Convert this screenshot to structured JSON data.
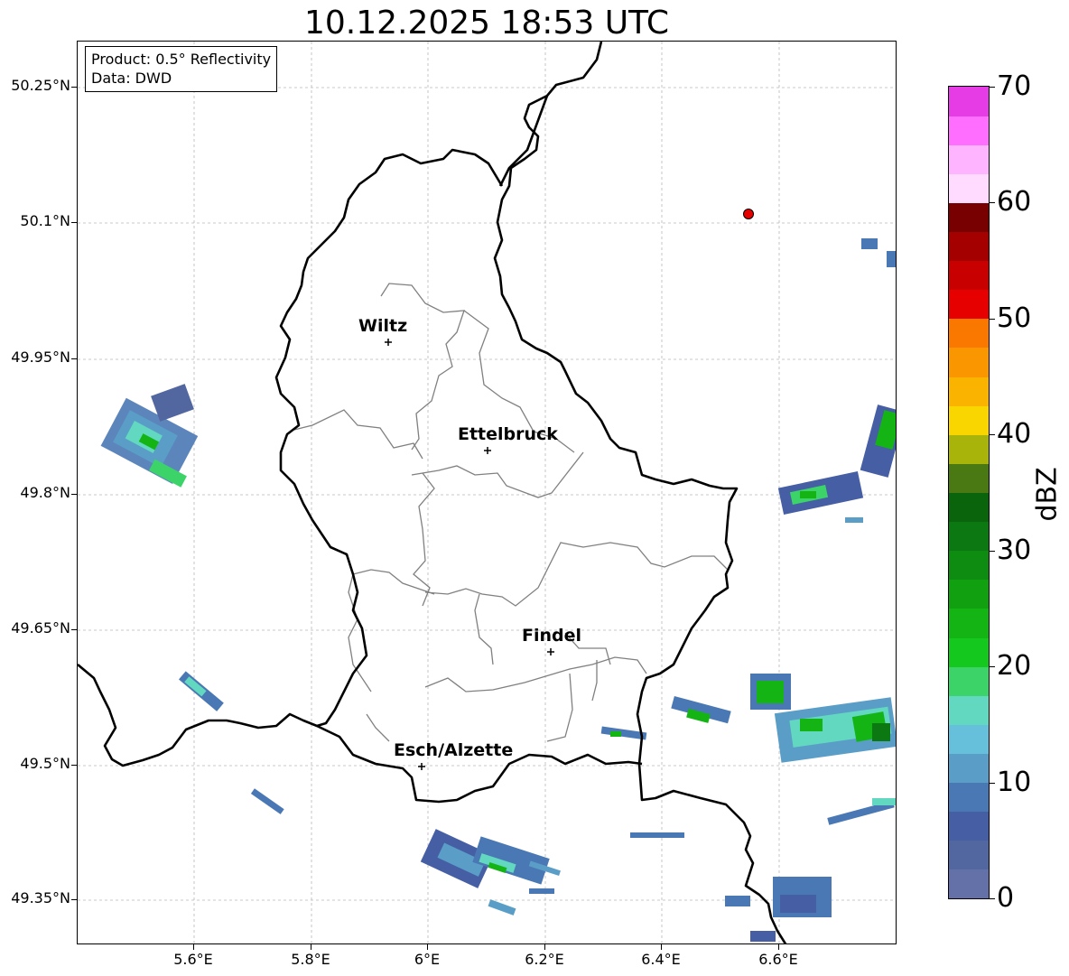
{
  "title": "10.12.2025 18:53 UTC",
  "info": {
    "product": "Product: 0.5° Reflectivity",
    "data": "Data: DWD"
  },
  "lat_ticks": [
    "50.25°N",
    "50.1°N",
    "49.95°N",
    "49.8°N",
    "49.65°N",
    "49.5°N",
    "49.35°N"
  ],
  "lon_ticks": [
    "5.6°E",
    "5.8°E",
    "6°E",
    "6.2°E",
    "6.4°E",
    "6.6°E"
  ],
  "cities": [
    {
      "name": "Wiltz"
    },
    {
      "name": "Ettelbruck"
    },
    {
      "name": "Findel"
    },
    {
      "name": "Esch/Alzette"
    }
  ],
  "colorbar": {
    "label": "dBZ",
    "ticks": [
      "0",
      "10",
      "20",
      "30",
      "40",
      "50",
      "60",
      "70"
    ],
    "colors": [
      "#6470a8",
      "#52679f",
      "#455ea4",
      "#4a78b4",
      "#5a9ec8",
      "#66c0dc",
      "#62d8c0",
      "#3cd468",
      "#14c81e",
      "#14b414",
      "#10a010",
      "#0e8c12",
      "#0c7812",
      "#0a640c",
      "#4a7812",
      "#a8b40a",
      "#fad600",
      "#fab400",
      "#fa9600",
      "#fa7800",
      "#e60000",
      "#c80000",
      "#a50000",
      "#780000",
      "#ffdcff",
      "#ffb4ff",
      "#ff6eff",
      "#e63ce6"
    ]
  },
  "marker": {
    "type": "radar-site",
    "color": "#e60000"
  },
  "colors": {
    "border": "#000000",
    "canton": "#808080",
    "grid": "#b0b0b0"
  }
}
